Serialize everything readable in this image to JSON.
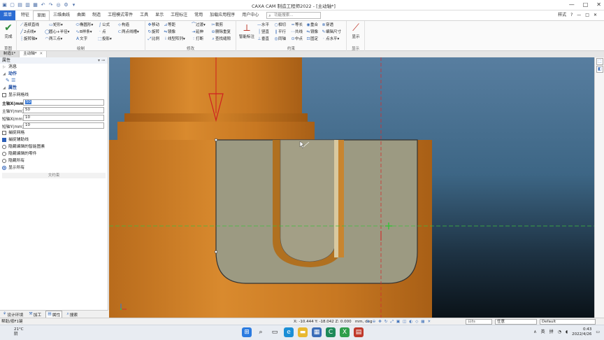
{
  "window": {
    "title": "CAXA CAM 制造工程师2022 - [主动轴*]",
    "controls": [
      "—",
      "□",
      "✕"
    ]
  },
  "ribbon_tabs": [
    "菜单",
    "特征",
    "草图",
    "三维曲线",
    "曲面",
    "制造",
    "工程模式零件",
    "工具",
    "显示",
    "工程标注",
    "常用",
    "加载应用程序",
    "用户中心"
  ],
  "search": {
    "placeholder": "功能搜索..."
  },
  "style_menu": {
    "label": "样式",
    "icons": [
      "?",
      "—",
      "□",
      "✕"
    ]
  },
  "ribbon_groups": {
    "sketch": {
      "label": "草图",
      "finish": "完成"
    },
    "draw": {
      "label": "绘制",
      "items": [
        "连续直线",
        "矩形",
        "椭圆形",
        "公式",
        "构造",
        "2点线",
        "圆心+半径",
        "B样条",
        "点",
        "两点线槽",
        "旋转轴",
        "两三点",
        "文字",
        "投影"
      ]
    },
    "modify": {
      "label": "修改",
      "items": [
        "移动",
        "等距",
        "过渡",
        "裁剪",
        "旋转",
        "镜像",
        "延伸",
        "删除重复",
        "比例",
        "线型阵列",
        "打断",
        "查找缝隙"
      ]
    },
    "constrain": {
      "label": "约束",
      "smart": "智能标注",
      "items": [
        "水平",
        "相切",
        "等长",
        "重合",
        "穿透",
        "竖直",
        "平行",
        "共线",
        "镜像",
        "编辑尺寸",
        "垂直",
        "同轴",
        "中点",
        "固定",
        "点水平"
      ]
    },
    "display": {
      "label": "显示",
      "btn": "显示"
    }
  },
  "doc_tabs": [
    "制造1*",
    "主动轴*"
  ],
  "panel": {
    "title": "属性",
    "tree": [
      {
        "label": "消息",
        "bold": false
      },
      {
        "label": "动作",
        "bold": true
      }
    ],
    "props_header": "属性",
    "show_grid": "显示网格线",
    "fields": [
      {
        "label": "主轴X(mm)",
        "value": "50",
        "highlight": true
      },
      {
        "label": "主轴Y(mm)",
        "value": "50",
        "highlight": false
      },
      {
        "label": "短轴X(mm)",
        "value": "10",
        "highlight": false
      },
      {
        "label": "短轴Y(mm)",
        "value": "10",
        "highlight": false
      }
    ],
    "checks": [
      {
        "label": "捕捉网格",
        "on": false
      },
      {
        "label": "捕捉辅助线",
        "on": true
      }
    ],
    "radios": [
      {
        "label": "隐藏编辑的智能图素",
        "on": false
      },
      {
        "label": "隐藏编辑的零件",
        "on": false
      },
      {
        "label": "隐藏所有",
        "on": false
      },
      {
        "label": "显示所有",
        "on": true
      }
    ],
    "constraint_bar": "文约束",
    "footer_tabs": [
      "设计环境",
      "加工",
      "属性",
      "搜索"
    ]
  },
  "status": {
    "left": "帮助/按F1键",
    "coords": "X: -10.444 Y: -18.042 Z: 0.000",
    "units": "mm, deg",
    "search_placeholder": "目标",
    "mode": "任意",
    "style": "Default"
  },
  "taskbar": {
    "weather_temp": "21°C",
    "weather_desc": "阴",
    "tray": [
      "∧",
      "英",
      "拼"
    ],
    "time": "0:43",
    "date": "2022/4/26"
  }
}
